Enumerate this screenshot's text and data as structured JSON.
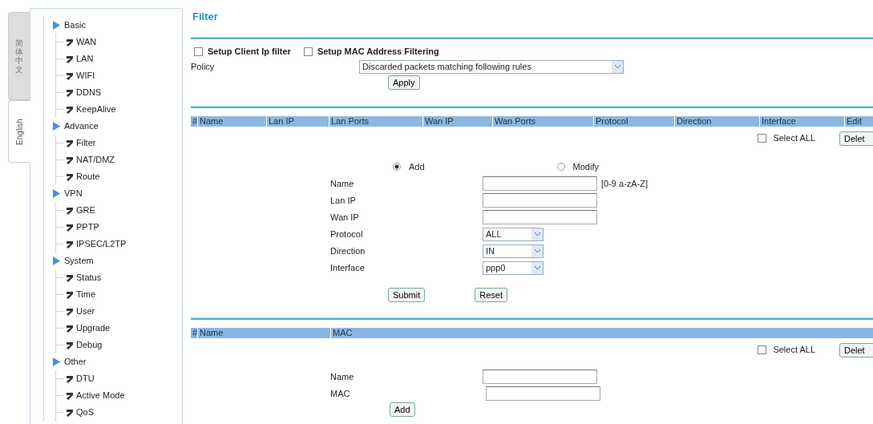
{
  "language_tabs": [
    {
      "label": "简体中文",
      "selected": false
    },
    {
      "label": "English",
      "selected": true
    }
  ],
  "sidebar": {
    "groups": [
      {
        "label": "Basic",
        "children": [
          {
            "label": "WAN"
          },
          {
            "label": "LAN"
          },
          {
            "label": "WIFI"
          },
          {
            "label": "DDNS"
          },
          {
            "label": "KeepAlive"
          }
        ]
      },
      {
        "label": "Advance",
        "children": [
          {
            "label": "Filter"
          },
          {
            "label": "NAT/DMZ"
          },
          {
            "label": "Route"
          }
        ]
      },
      {
        "label": "VPN",
        "children": [
          {
            "label": "GRE"
          },
          {
            "label": "PPTP"
          },
          {
            "label": "IPSEC/L2TP"
          }
        ]
      },
      {
        "label": "System",
        "children": [
          {
            "label": "Status"
          },
          {
            "label": "Time"
          },
          {
            "label": "User"
          },
          {
            "label": "Upgrade"
          },
          {
            "label": "Debug"
          }
        ]
      },
      {
        "label": "Other",
        "children": [
          {
            "label": "DTU"
          },
          {
            "label": "Active Mode"
          },
          {
            "label": "QoS"
          }
        ]
      }
    ]
  },
  "page_title": "Filter",
  "options": [
    {
      "label": "Setup Client Ip filter",
      "checked": false
    },
    {
      "label": "Setup MAC Address Filtering",
      "checked": false
    }
  ],
  "policy": {
    "label": "Policy",
    "value": "Discarded packets matching following rules"
  },
  "apply_button": "Apply",
  "ip_table": {
    "columns": [
      "#",
      "Name",
      "Lan IP",
      "Lan Ports",
      "Wan IP",
      "Wan Ports",
      "Protocol",
      "Direction",
      "Interface",
      "Edit"
    ],
    "select_all": {
      "label": "Select ALL",
      "checked": false
    },
    "delete_button": "Delet"
  },
  "ip_form": {
    "modes": [
      {
        "label": "Add",
        "selected": true
      },
      {
        "label": "Modify",
        "selected": false
      }
    ],
    "fields": [
      {
        "kind": "text",
        "label": "Name",
        "hint": "[0-9 a-zA-Z]"
      },
      {
        "kind": "text",
        "label": "Lan IP"
      },
      {
        "kind": "text",
        "label": "Wan IP"
      },
      {
        "kind": "select",
        "label": "Protocol",
        "value": "ALL"
      },
      {
        "kind": "select",
        "label": "Direction",
        "value": "IN"
      },
      {
        "kind": "select",
        "label": "Interface",
        "value": "ppp0"
      }
    ],
    "buttons": [
      "Submit",
      "Reset"
    ]
  },
  "mac_table": {
    "columns": [
      "#",
      "Name",
      "MAC"
    ],
    "select_all": {
      "label": "Select ALL",
      "checked": false
    },
    "delete_button": "Delet"
  },
  "mac_form": {
    "fields": [
      {
        "label": "Name"
      },
      {
        "label": "MAC"
      }
    ],
    "button": "Add"
  }
}
